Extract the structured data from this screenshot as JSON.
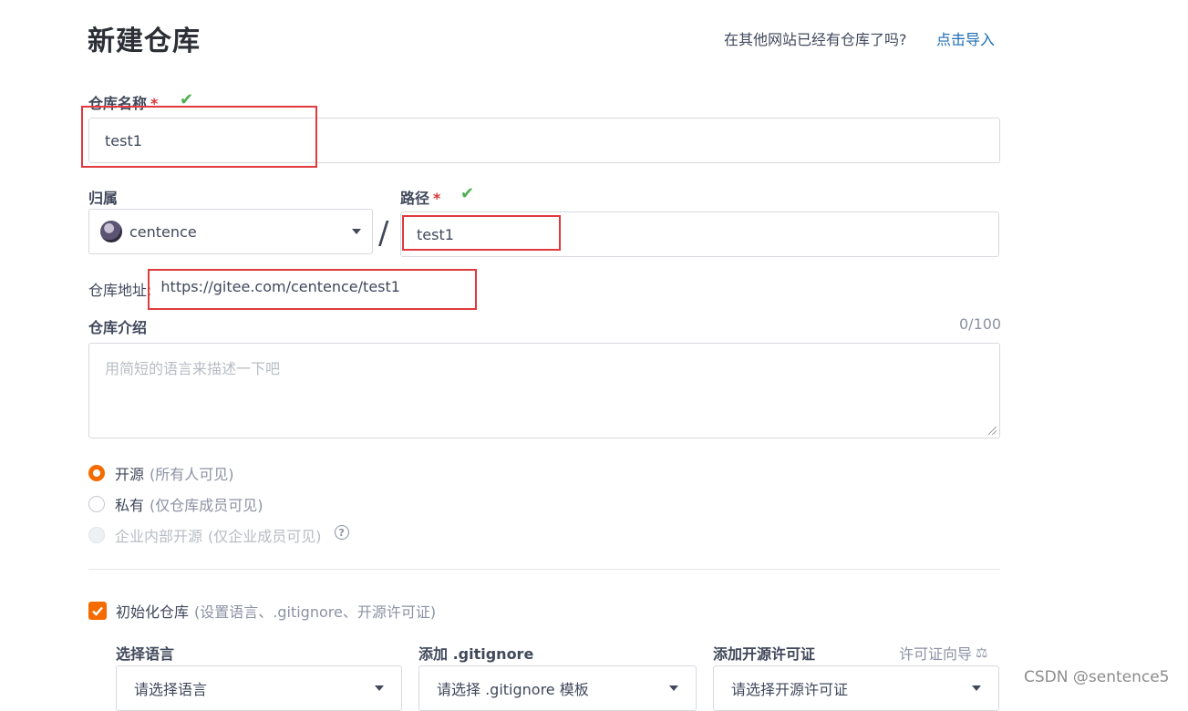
{
  "header": {
    "title": "新建仓库",
    "import_question": "在其他网站已经有仓库了吗?",
    "import_link": "点击导入"
  },
  "repo_name": {
    "label": "仓库名称",
    "required_mark": "*",
    "value": "test1"
  },
  "owner": {
    "label": "归属",
    "value": "centence"
  },
  "separator": "/",
  "path": {
    "label": "路径",
    "required_mark": "*",
    "value": "test1"
  },
  "repo_address": {
    "label": "仓库地址:",
    "url": "https://gitee.com/centence/test1"
  },
  "description": {
    "label": "仓库介绍",
    "counter": "0/100",
    "placeholder": "用简短的语言来描述一下吧"
  },
  "visibility": {
    "options": [
      {
        "label": "开源",
        "sub": "(所有人可见)",
        "state": "selected"
      },
      {
        "label": "私有",
        "sub": "(仅仓库成员可见)",
        "state": "unselected"
      },
      {
        "label": "企业内部开源",
        "sub": "(仅企业成员可见)",
        "state": "disabled"
      }
    ],
    "help_icon": "?"
  },
  "init_repo": {
    "label": "初始化仓库",
    "sub": "(设置语言、.gitignore、开源许可证)",
    "checked": true
  },
  "language": {
    "label": "选择语言",
    "value": "请选择语言"
  },
  "gitignore": {
    "label": "添加 .gitignore",
    "value": "请选择 .gitignore 模板"
  },
  "license": {
    "label": "添加开源许可证",
    "guide_link": "许可证向导",
    "guide_icon": "scale-icon",
    "value": "请选择开源许可证"
  },
  "watermark": "CSDN @sentence5",
  "colors": {
    "accent": "#f56b00",
    "link": "#1c6db4",
    "required": "#d9383a",
    "check": "#4caf50",
    "annotation": "#e0393e"
  }
}
